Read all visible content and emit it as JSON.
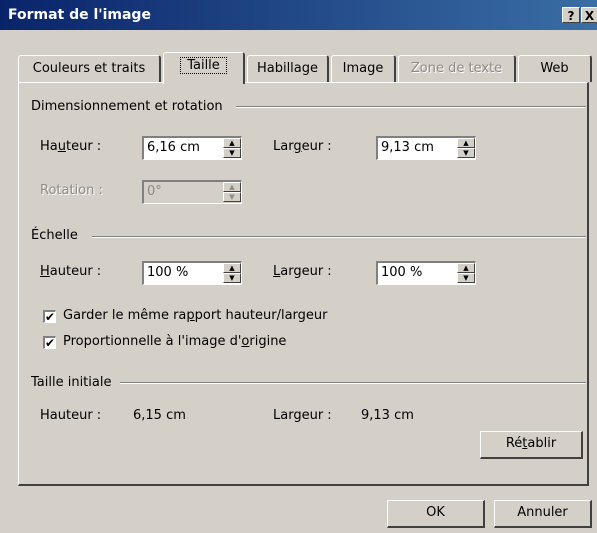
{
  "window": {
    "title": "Format de l'image",
    "help_label": "?",
    "close_label": "X"
  },
  "tabs": [
    {
      "label": "Couleurs et traits"
    },
    {
      "label": "Taille"
    },
    {
      "label": "Habillage"
    },
    {
      "label": "Image"
    },
    {
      "label": "Zone de texte"
    },
    {
      "label": "Web"
    }
  ],
  "sizing": {
    "heading": "Dimensionnement et rotation",
    "height_label_pre": "Ha",
    "height_label_u": "u",
    "height_label_post": "teur :",
    "height_value": "6,16 cm",
    "width_label_pre": "Lar",
    "width_label_u": "g",
    "width_label_post": "eur :",
    "width_value": "9,13 cm",
    "rotation_label": "Rotation :",
    "rotation_value": "0°"
  },
  "scale": {
    "heading": "Échelle",
    "height_label_u": "H",
    "height_label_post": "auteur :",
    "height_value": "100 %",
    "width_label_u": "L",
    "width_label_post": "argeur :",
    "width_value": "100 %",
    "lock_ratio_pre": "Garder le même ra",
    "lock_ratio_u": "p",
    "lock_ratio_post": "port hauteur/largeur",
    "relative_pre": "Proportionnelle à l'image d'",
    "relative_u": "o",
    "relative_post": "rigine",
    "check_glyph": "✔"
  },
  "original": {
    "heading": "Taille initiale",
    "height_label": "Hauteur :",
    "height_value": "6,15 cm",
    "width_label": "Largeur :",
    "width_value": "9,13 cm",
    "reset_pre": "Ré",
    "reset_u": "t",
    "reset_post": "ablir"
  },
  "buttons": {
    "ok": "OK",
    "cancel": "Annuler"
  }
}
